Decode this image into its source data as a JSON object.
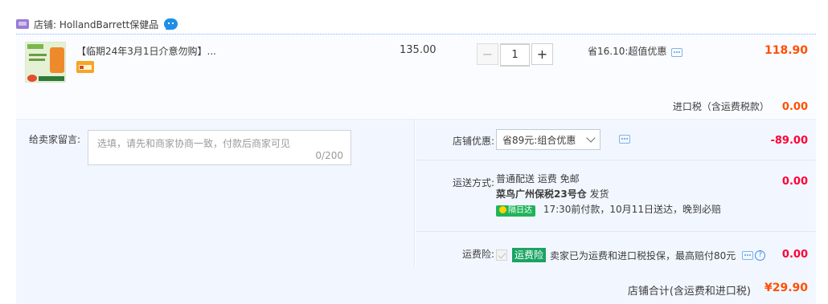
{
  "shop": {
    "label": "店铺: HollandBarrett保健品",
    "icon": "shop-icon",
    "chat_icon": "chat-bubble-icon"
  },
  "item": {
    "title": "【临期24年3月1日介意勿购】...",
    "unit_price": "135.00",
    "quantity": "1",
    "minus": "−",
    "plus": "+",
    "saving": "省16.10:超值优惠",
    "line_total": "118.90"
  },
  "tax": {
    "label": "进口税（含运费税款）",
    "value": "0.00"
  },
  "note": {
    "label": "给卖家留言:",
    "placeholder": "选填，请先和商家协商一致，付款后商家可见",
    "counter": "0/200"
  },
  "promo": {
    "label": "店铺优惠:",
    "selected": "省89元:组合优惠",
    "amount": "-89.00"
  },
  "shipping": {
    "label": "运送方式:",
    "method": "普通配送 运费 免邮",
    "warehouse": "菜鸟广州保税23号仓",
    "dispatch": "发货",
    "badge": "隔日达",
    "eta": "17:30前付款，10月11日送达，晚到必赔",
    "amount": "0.00"
  },
  "insurance": {
    "label": "运费险:",
    "badge": "运费险",
    "text": "卖家已为运费和进口税投保，最高赔付80元",
    "help": "?",
    "amount": "0.00"
  },
  "summary": {
    "label": "店铺合计(含运费和进口税)",
    "value": "¥29.90"
  },
  "colors": {
    "accent": "#ff5000",
    "discount": "#ff0036",
    "panel_bg": "#f2f7ff",
    "link_blue": "#1f8ee6"
  }
}
